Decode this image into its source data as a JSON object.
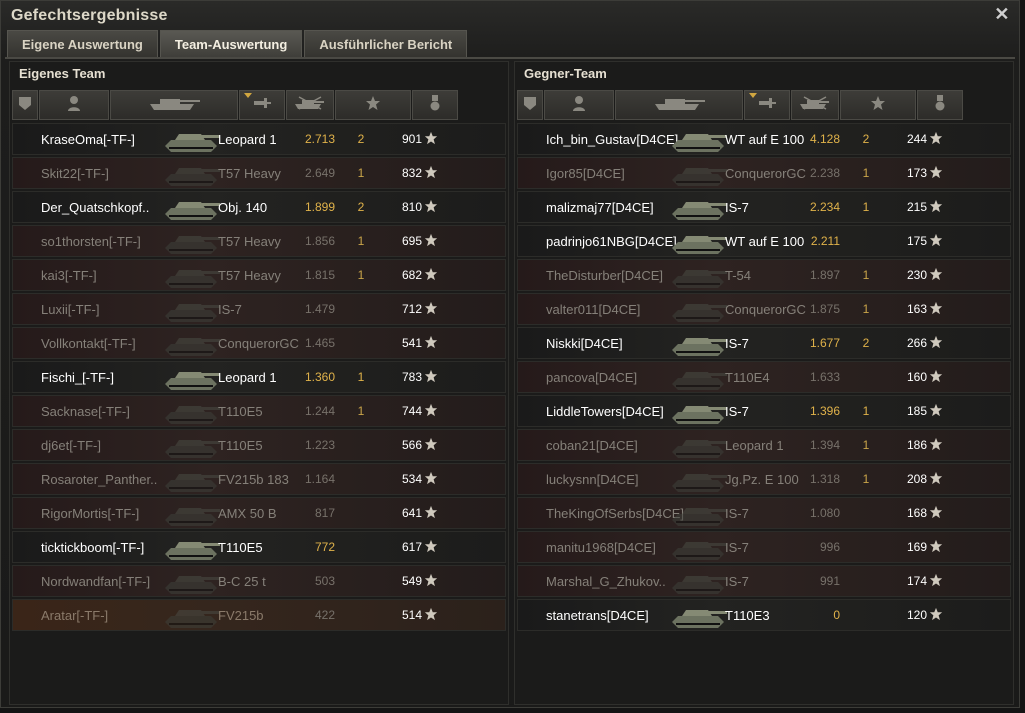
{
  "window": {
    "title": "Gefechtsergebnisse"
  },
  "tabs": [
    {
      "label": "Eigene Auswertung",
      "active": false
    },
    {
      "label": "Team-Auswertung",
      "active": true
    },
    {
      "label": "Ausführlicher Bericht",
      "active": false
    }
  ],
  "colors": {
    "accent": "#e0b24a",
    "dead_text": "#858079",
    "alive_text": "#ffffff"
  },
  "teams": {
    "own": {
      "title": "Eigenes Team",
      "rows": [
        {
          "name": "KraseOma[-TF-]",
          "tank": "Leopard 1",
          "damage": "2.713",
          "kills": "2",
          "xp": "901",
          "status": "alive"
        },
        {
          "name": "Skit22[-TF-]",
          "tank": "T57 Heavy",
          "damage": "2.649",
          "kills": "1",
          "xp": "832",
          "status": "dead"
        },
        {
          "name": "Der_Quatschkopf..",
          "tank": "Obj. 140",
          "damage": "1.899",
          "kills": "2",
          "xp": "810",
          "status": "alive"
        },
        {
          "name": "so1thorsten[-TF-]",
          "tank": "T57 Heavy",
          "damage": "1.856",
          "kills": "1",
          "xp": "695",
          "status": "dead"
        },
        {
          "name": "kai3[-TF-]",
          "tank": "T57 Heavy",
          "damage": "1.815",
          "kills": "1",
          "xp": "682",
          "status": "dead"
        },
        {
          "name": "Luxii[-TF-]",
          "tank": "IS-7",
          "damage": "1.479",
          "kills": "",
          "xp": "712",
          "status": "dead"
        },
        {
          "name": "Vollkontakt[-TF-]",
          "tank": "ConquerorGC",
          "damage": "1.465",
          "kills": "",
          "xp": "541",
          "status": "dead"
        },
        {
          "name": "Fischi_[-TF-]",
          "tank": "Leopard 1",
          "damage": "1.360",
          "kills": "1",
          "xp": "783",
          "status": "alive"
        },
        {
          "name": "Sacknase[-TF-]",
          "tank": "T110E5",
          "damage": "1.244",
          "kills": "1",
          "xp": "744",
          "status": "dead"
        },
        {
          "name": "dj6et[-TF-]",
          "tank": "T110E5",
          "damage": "1.223",
          "kills": "",
          "xp": "566",
          "status": "dead"
        },
        {
          "name": "Rosaroter_Panther..",
          "tank": "FV215b 183",
          "damage": "1.164",
          "kills": "",
          "xp": "534",
          "status": "dead"
        },
        {
          "name": "RigorMortis[-TF-]",
          "tank": "AMX 50 B",
          "damage": "817",
          "kills": "",
          "xp": "641",
          "status": "dead"
        },
        {
          "name": "ticktickboom[-TF-]",
          "tank": "T110E5",
          "damage": "772",
          "kills": "",
          "xp": "617",
          "status": "alive"
        },
        {
          "name": "Nordwandfan[-TF-]",
          "tank": "B-C 25 t",
          "damage": "503",
          "kills": "",
          "xp": "549",
          "status": "dead"
        },
        {
          "name": "Aratar[-TF-]",
          "tank": "FV215b",
          "damage": "422",
          "kills": "",
          "xp": "514",
          "status": "self"
        }
      ]
    },
    "enemy": {
      "title": "Gegner-Team",
      "rows": [
        {
          "name": "Ich_bin_Gustav[D4CE]",
          "tank": "WT auf E 100",
          "damage": "4.128",
          "kills": "2",
          "xp": "244",
          "status": "alive"
        },
        {
          "name": "Igor85[D4CE]",
          "tank": "ConquerorGC",
          "damage": "2.238",
          "kills": "1",
          "xp": "173",
          "status": "dead"
        },
        {
          "name": "malizmaj77[D4CE]",
          "tank": "IS-7",
          "damage": "2.234",
          "kills": "1",
          "xp": "215",
          "status": "alive"
        },
        {
          "name": "padrinjo61NBG[D4CE]",
          "tank": "WT auf E 100",
          "damage": "2.211",
          "kills": "",
          "xp": "175",
          "status": "alive"
        },
        {
          "name": "TheDisturber[D4CE]",
          "tank": "T-54",
          "damage": "1.897",
          "kills": "1",
          "xp": "230",
          "status": "dead"
        },
        {
          "name": "valter011[D4CE]",
          "tank": "ConquerorGC",
          "damage": "1.875",
          "kills": "1",
          "xp": "163",
          "status": "dead"
        },
        {
          "name": "Niskki[D4CE]",
          "tank": "IS-7",
          "damage": "1.677",
          "kills": "2",
          "xp": "266",
          "status": "alive"
        },
        {
          "name": "pancova[D4CE]",
          "tank": "T110E4",
          "damage": "1.633",
          "kills": "",
          "xp": "160",
          "status": "dead"
        },
        {
          "name": "LiddleTowers[D4CE]",
          "tank": "IS-7",
          "damage": "1.396",
          "kills": "1",
          "xp": "185",
          "status": "alive"
        },
        {
          "name": "coban21[D4CE]",
          "tank": "Leopard 1",
          "damage": "1.394",
          "kills": "1",
          "xp": "186",
          "status": "dead"
        },
        {
          "name": "luckysnn[D4CE]",
          "tank": "Jg.Pz. E 100",
          "damage": "1.318",
          "kills": "1",
          "xp": "208",
          "status": "dead"
        },
        {
          "name": "TheKingOfSerbs[D4CE]",
          "tank": "IS-7",
          "damage": "1.080",
          "kills": "",
          "xp": "168",
          "status": "dead"
        },
        {
          "name": "manitu1968[D4CE]",
          "tank": "IS-7",
          "damage": "996",
          "kills": "",
          "xp": "169",
          "status": "dead"
        },
        {
          "name": "Marshal_G_Zhukov..",
          "tank": "IS-7",
          "damage": "991",
          "kills": "",
          "xp": "174",
          "status": "dead"
        },
        {
          "name": "stanetrans[D4CE]",
          "tank": "T110E3",
          "damage": "0",
          "kills": "",
          "xp": "120",
          "status": "alive"
        }
      ]
    }
  },
  "columns": [
    {
      "icon": "platoon-icon"
    },
    {
      "icon": "player-icon"
    },
    {
      "icon": "tank-icon"
    },
    {
      "icon": "damage-icon",
      "sorted": true
    },
    {
      "icon": "kills-icon"
    },
    {
      "icon": "star-icon"
    },
    {
      "icon": "medal-icon"
    }
  ]
}
